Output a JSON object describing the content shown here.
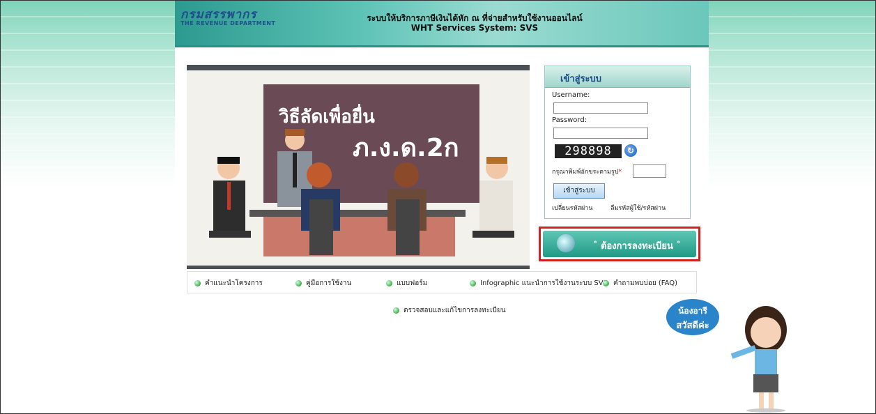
{
  "header": {
    "logo_thai": "กรมสรรพากร",
    "logo_english": "THE REVENUE DEPARTMENT",
    "title_line1": "ระบบให้บริการภาษีเงินได้หัก ณ ที่จ่ายสำหรับใช้งานออนไลน์",
    "title_line2": "WHT Services System: SVS"
  },
  "banner": {
    "line1": "วิธีลัดเพื่อยื่น",
    "line2": "ภ.ง.ด.2ก"
  },
  "login": {
    "title": "เข้าสู่ระบบ",
    "username_label": "Username:",
    "username_value": "",
    "password_label": "Password:",
    "password_value": "",
    "captcha_text": "298898",
    "captcha_prompt": "กรุณาพิมพ์อักขระตามรูป",
    "required_mark": "*",
    "captcha_value": "",
    "submit_label": "เข้าสู่ระบบ",
    "change_password_link": "เปลี่ยนรหัสผ่าน",
    "forgot_link": "ลืมรหัสผู้ใช้/รหัสผ่าน"
  },
  "register": {
    "label": "ต้องการลงทะเบียน"
  },
  "menu": {
    "items": [
      "คำแนะนำโครงการ",
      "คู่มือการใช้งาน",
      "แบบฟอร์ม",
      "Infographic แนะนำการใช้งานระบบ SVS",
      "คำถามพบบ่อย (FAQ)"
    ],
    "check_registration": "ตรวจสอบและแก้ไขการลงทะเบียน"
  },
  "mascot": {
    "name": "น้องอารี",
    "greeting": "สวัสดีค่ะ"
  },
  "colors": {
    "accent": "#2d9a8f",
    "highlight_border": "#d02020"
  }
}
